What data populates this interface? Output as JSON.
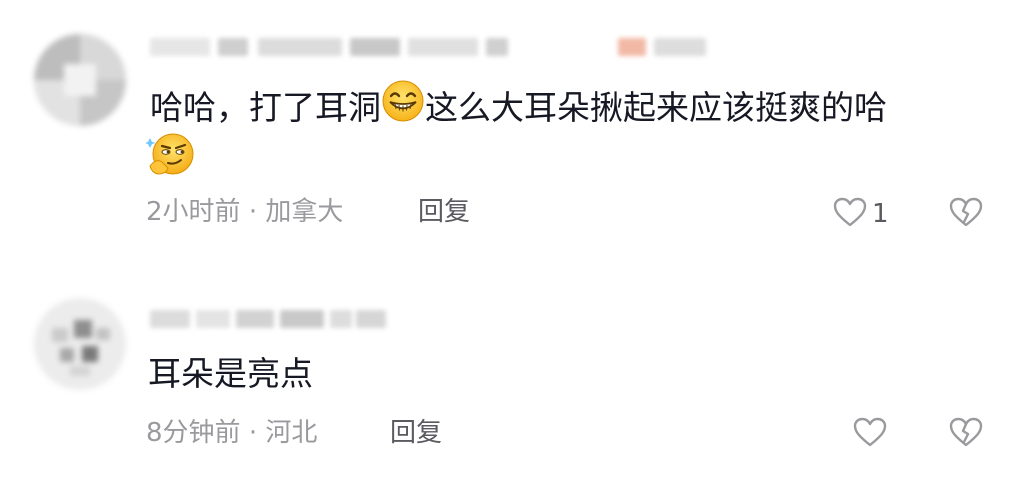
{
  "comments": [
    {
      "text": "哈哈，打了耳洞",
      "text_after_emoji": "这么大耳朵揪起来应该挺爽的哈",
      "emoji_inline": "grin-emoji",
      "emoji_trailing": "smirk-emoji",
      "time": "2小时前",
      "separator": "·",
      "location": "加拿大",
      "reply_label": "回复",
      "like_count": "1"
    },
    {
      "text": "耳朵是亮点",
      "time": "8分钟前",
      "separator": "·",
      "location": "河北",
      "reply_label": "回复",
      "like_count": ""
    }
  ],
  "colors": {
    "text": "#161823",
    "meta": "#9a9a9e",
    "reply": "#5a5a60",
    "icon": "#9a9a9e"
  },
  "icons": {
    "like": "heart-outline-icon",
    "dislike": "broken-heart-icon"
  }
}
